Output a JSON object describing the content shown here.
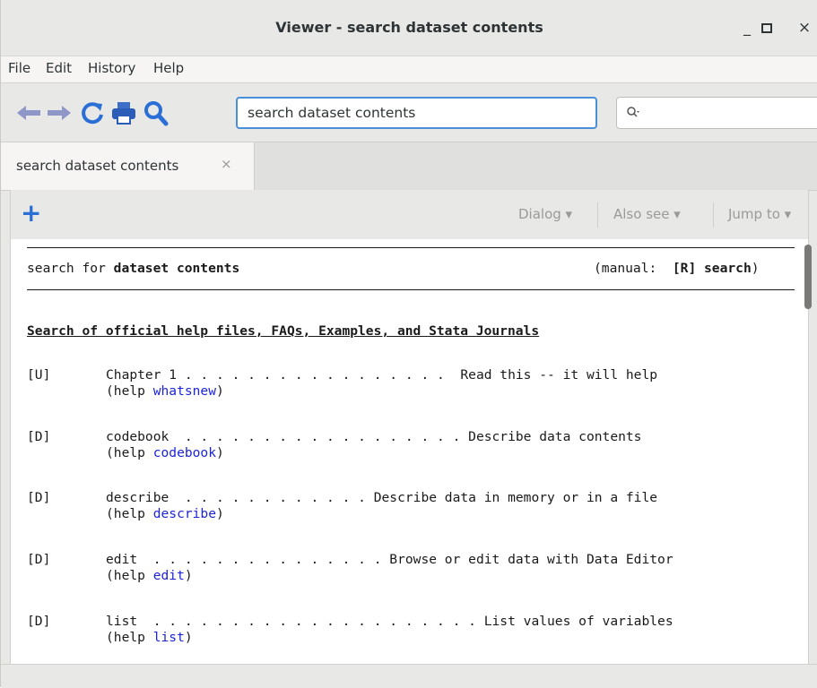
{
  "window": {
    "title": "Viewer - search dataset contents",
    "minimize": "_",
    "maximize": "▫",
    "close": "×"
  },
  "menu": [
    "File",
    "Edit",
    "History",
    "Help"
  ],
  "toolbar": {
    "address_value": "search dataset contents",
    "search_placeholder": ""
  },
  "tab": {
    "label": "search dataset contents",
    "close": "×"
  },
  "doc_toolbar": {
    "add": "+",
    "dialog": "Dialog ▾",
    "also_see": "Also see ▾",
    "jump_to": "Jump to ▾"
  },
  "content": {
    "search_prefix": "search for ",
    "search_term": "dataset contents",
    "manual_prefix": "(manual:  ",
    "manual_ref": "[R] search",
    "manual_suffix": ")",
    "heading": "Search of official help files, FAQs, Examples, and Stata Journals",
    "entries": [
      {
        "tag": "[U]",
        "title": "Chapter 1 . . . . . . . . . . . . . . . . .  Read this -- it will help",
        "help_prefix": "(help ",
        "help_link": "whatsnew",
        "help_suffix": ")"
      },
      {
        "tag": "[D]",
        "title": "codebook  . . . . . . . . . . . . . . . . . . Describe data contents",
        "help_prefix": "(help ",
        "help_link": "codebook",
        "help_suffix": ")"
      },
      {
        "tag": "[D]",
        "title": "describe  . . . . . . . . . . . . Describe data in memory or in a file",
        "help_prefix": "(help ",
        "help_link": "describe",
        "help_suffix": ")"
      },
      {
        "tag": "[D]",
        "title": "edit  . . . . . . . . . . . . . . . Browse or edit data with Data Editor",
        "help_prefix": "(help ",
        "help_link": "edit",
        "help_suffix": ")"
      },
      {
        "tag": "[D]",
        "title": "list  . . . . . . . . . . . . . . . . . . . . . List values of variables",
        "help_prefix": "(help ",
        "help_link": "list",
        "help_suffix": ")"
      }
    ]
  }
}
